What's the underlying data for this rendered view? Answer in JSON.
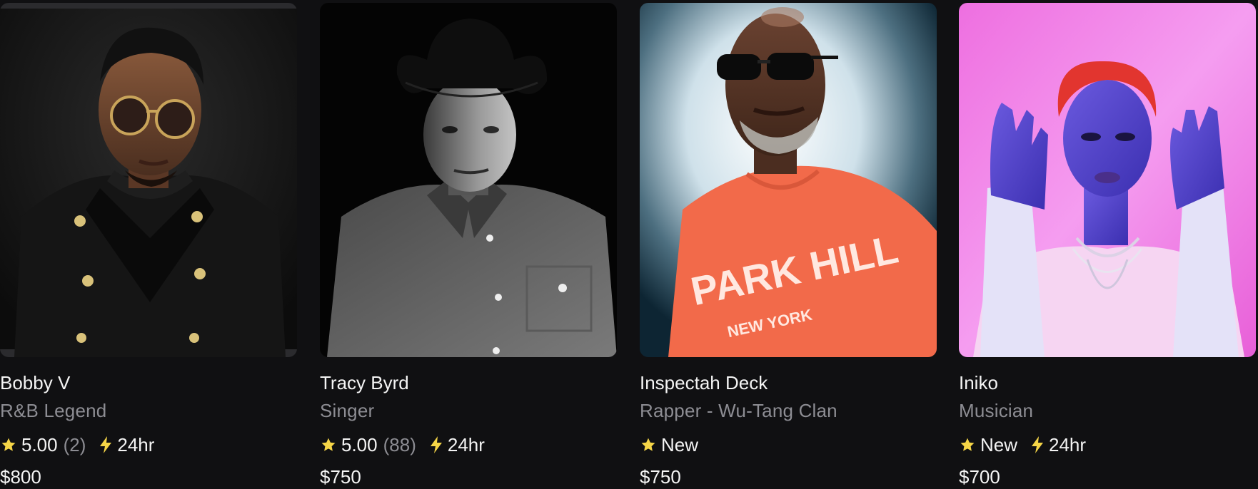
{
  "cards": [
    {
      "name": "Bobby V",
      "role": "R&B Legend",
      "rating": "5.00",
      "review_count": "(2)",
      "response_time": "24hr",
      "price": "$800"
    },
    {
      "name": "Tracy Byrd",
      "role": "Singer",
      "rating": "5.00",
      "review_count": "(88)",
      "response_time": "24hr",
      "price": "$750"
    },
    {
      "name": "Inspectah Deck",
      "role": "Rapper - Wu-Tang Clan",
      "rating": "New",
      "review_count": "",
      "response_time": "",
      "price": "$750"
    },
    {
      "name": "Iniko",
      "role": "Musician",
      "rating": "New",
      "review_count": "",
      "response_time": "24hr",
      "price": "$700"
    }
  ],
  "photo_texts": {
    "shirt_line1": "PARK HILL",
    "shirt_line2": "NEW YORK"
  },
  "colors": {
    "background": "#101012",
    "star": "#f5d547",
    "bolt": "#f5d547",
    "muted_text": "#8d8d93",
    "primary_text": "#f4f4f4"
  },
  "icons": {
    "rating": "star-icon",
    "response": "lightning-bolt-icon"
  }
}
